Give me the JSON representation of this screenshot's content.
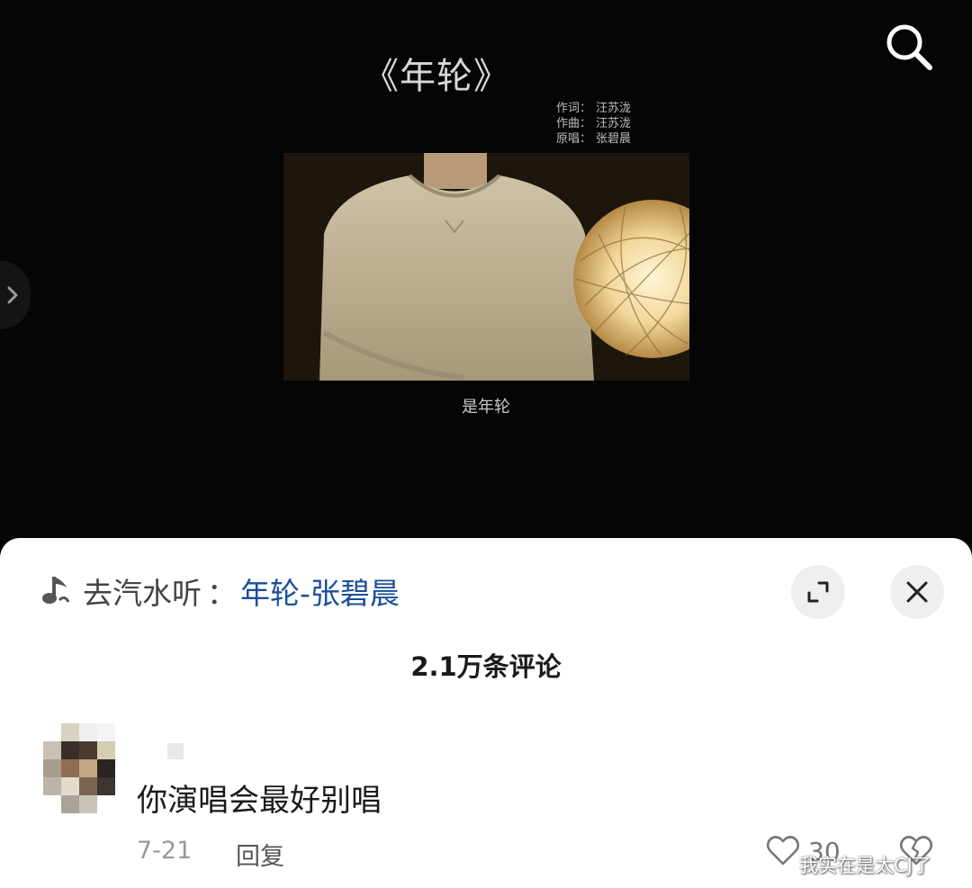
{
  "video": {
    "song_title": "《年轮》",
    "credits": [
      {
        "label": "作词：",
        "value": "汪苏泷"
      },
      {
        "label": "作曲：",
        "value": "汪苏泷"
      },
      {
        "label": "原唱：",
        "value": "张碧晨"
      }
    ],
    "subtitle": "是年轮",
    "icons": {
      "search": "search-icon",
      "side_arrow": "chevron-right-icon"
    }
  },
  "sheet": {
    "music_prefix": "去汽水听",
    "music_separator": "：",
    "music_link": "年轮-张碧晨",
    "link_color": "#1a4f9c",
    "comment_count": "2.1万条评论",
    "icons": {
      "music": "music-note-icon",
      "expand": "expand-icon",
      "close": "close-icon"
    }
  },
  "comment": {
    "text": "你演唱会最好别唱",
    "date": "7-21",
    "reply_label": "回复",
    "like_count": "30",
    "icons": {
      "like": "heart-icon",
      "dislike": "broken-heart-icon"
    }
  },
  "watermark": "我实在是太CJ了"
}
